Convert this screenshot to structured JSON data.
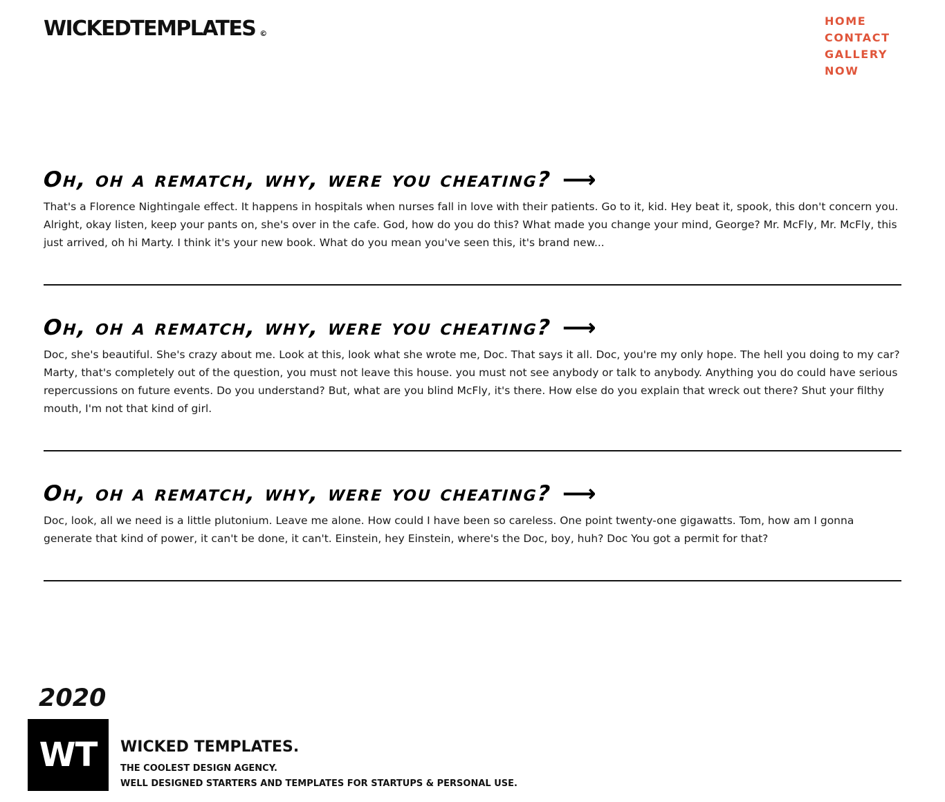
{
  "header": {
    "brand": "WICKEDTEMPLATES",
    "brand_mark": "©",
    "nav": [
      {
        "label": "HOME"
      },
      {
        "label": "CONTACT"
      },
      {
        "label": "GALLERY"
      },
      {
        "label": "NOW"
      }
    ],
    "nav_color": "#e0553a"
  },
  "posts": [
    {
      "title": "Oh, oh a rematch, why, were you cheating?",
      "arrow": "⟶",
      "body": "That's a Florence Nightingale effect. It happens in hospitals when nurses fall in love with their patients. Go to it, kid. Hey beat it, spook, this don't concern you. Alright, okay listen, keep your pants on, she's over in the cafe. God, how do you do this? What made you change your mind, George? Mr. McFly, Mr. McFly, this just arrived, oh hi Marty. I think it's your new book. What do you mean you've seen this, it's brand new..."
    },
    {
      "title": "Oh, oh a rematch, why, were you cheating?",
      "arrow": "⟶",
      "body": "Doc, she's beautiful. She's crazy about me. Look at this, look what she wrote me, Doc. That says it all. Doc, you're my only hope. The hell you doing to my car? Marty, that's completely out of the question, you must not leave this house. you must not see anybody or talk to anybody. Anything you do could have serious repercussions on future events. Do you understand? But, what are you blind McFly, it's there. How else do you explain that wreck out there? Shut your filthy mouth, I'm not that kind of girl."
    },
    {
      "title": "Oh, oh a rematch, why, were you cheating?",
      "arrow": "⟶",
      "body": "Doc, look, all we need is a little plutonium. Leave me alone. How could I have been so careless. One point twenty-one gigawatts. Tom, how am I gonna generate that kind of power, it can't be done, it can't. Einstein, hey Einstein, where's the Doc, boy, huh? Doc You got a permit for that?"
    }
  ],
  "footer": {
    "year": "2020",
    "logo": "WT",
    "name": "WICKED TEMPLATES.",
    "tagline_1": "THE COOLEST DESIGN AGENCY.",
    "tagline_2": "WELL DESIGNED STARTERS AND TEMPLATES FOR STARTUPS & PERSONAL USE."
  }
}
